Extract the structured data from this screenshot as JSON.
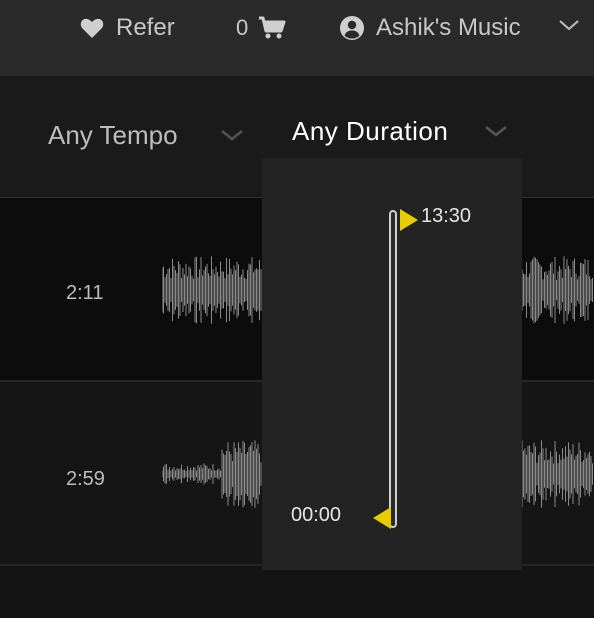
{
  "header": {
    "refer_label": "Refer",
    "cart_count": "0",
    "account_label": "Ashik's Music",
    "icons": [
      "heart-icon",
      "cart-icon",
      "user-circle-icon",
      "chevron-down-icon"
    ]
  },
  "filters": {
    "tempo_label": "Any Tempo",
    "duration_label": "Any Duration"
  },
  "duration_dropdown": {
    "max_label": "13:30",
    "min_label": "00:00",
    "accent_color": "#e8cc00"
  },
  "tracks": [
    {
      "duration": "2:11"
    },
    {
      "duration": "2:59"
    }
  ]
}
